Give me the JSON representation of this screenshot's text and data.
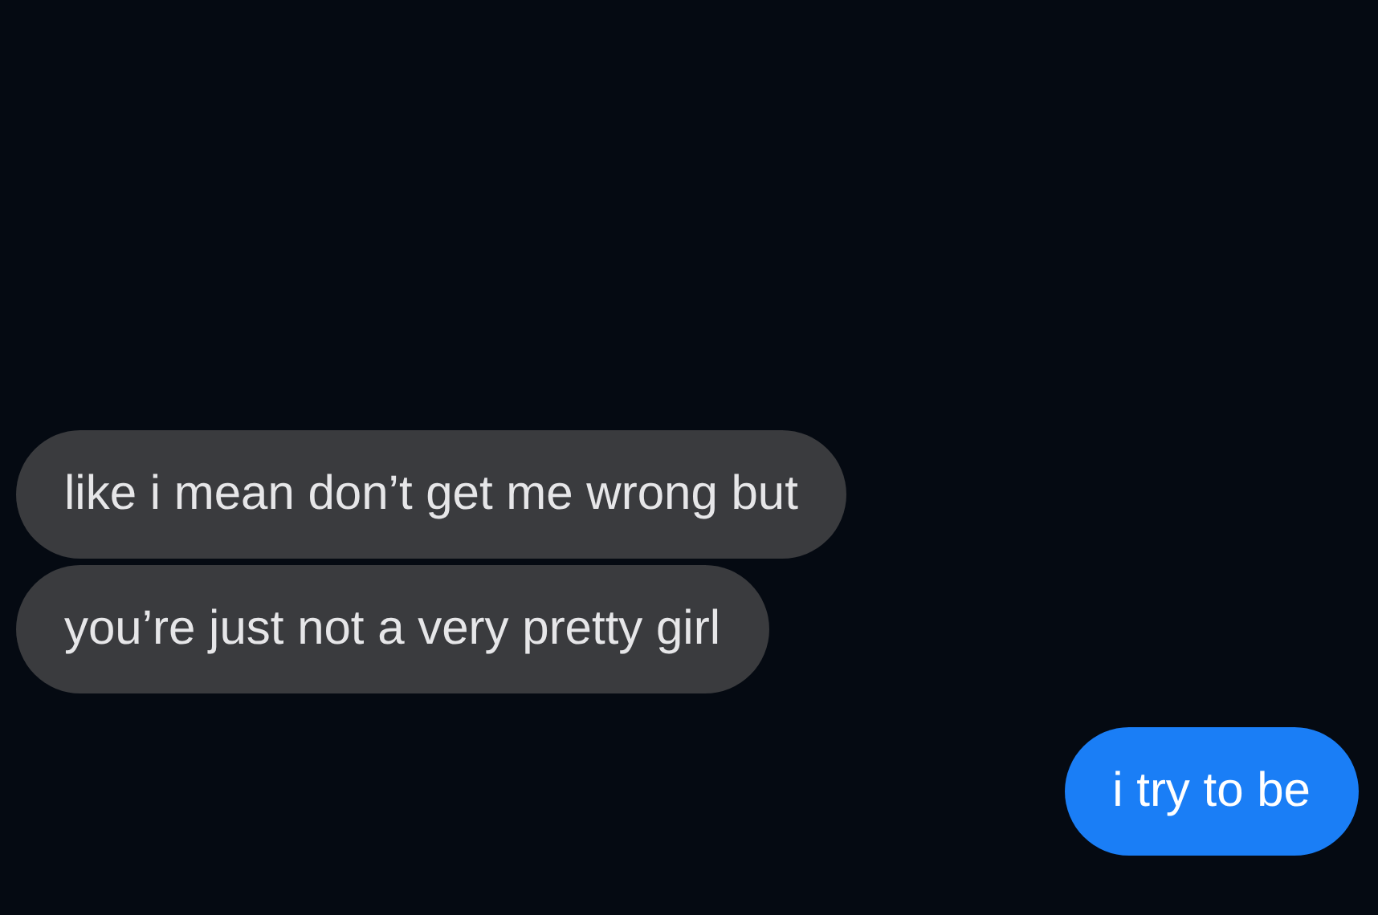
{
  "messages": [
    {
      "kind": "received",
      "text": "like i mean don’t get me wrong but"
    },
    {
      "kind": "received",
      "text": "you’re just not a very pretty girl"
    },
    {
      "kind": "sent",
      "text": "i try to be"
    }
  ]
}
